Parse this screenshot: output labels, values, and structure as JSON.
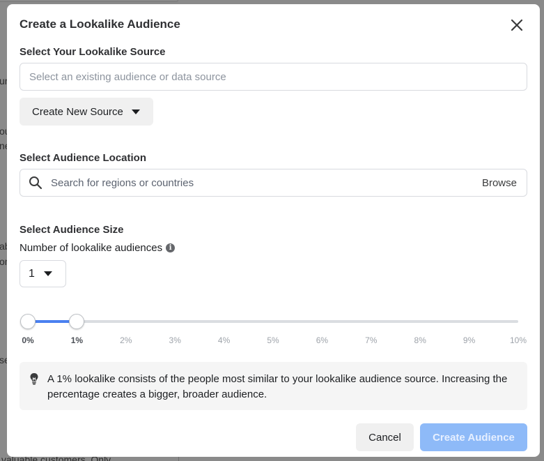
{
  "background": {
    "fragments": [
      "ur",
      "ou",
      "ne",
      "ab",
      "on",
      "se",
      "valuable customers. Only"
    ]
  },
  "modal": {
    "title": "Create a Lookalike Audience",
    "close_icon": "close-icon",
    "source": {
      "label": "Select Your Lookalike Source",
      "placeholder": "Select an existing audience or data source",
      "value": "",
      "create_button": "Create New Source"
    },
    "location": {
      "label": "Select Audience Location",
      "placeholder": "Search for regions or countries",
      "value": "",
      "browse": "Browse"
    },
    "size": {
      "label": "Select Audience Size",
      "count_label": "Number of lookalike audiences",
      "count_value": "1",
      "slider": {
        "min_percent": 0,
        "max_percent": 10,
        "range_start_percent": 0,
        "range_end_percent": 1,
        "ticks": [
          "0%",
          "1%",
          "2%",
          "3%",
          "4%",
          "5%",
          "6%",
          "7%",
          "8%",
          "9%",
          "10%"
        ],
        "active_ticks": [
          "0%",
          "1%"
        ]
      }
    },
    "tip": "A 1% lookalike consists of the people most similar to your lookalike audience source. Increasing the percentage creates a bigger, broader audience.",
    "footer": {
      "cancel": "Cancel",
      "create": "Create Audience",
      "create_enabled": false
    },
    "colors": {
      "accent": "#4a80f0",
      "primary_disabled": "#8ebaf8"
    }
  }
}
